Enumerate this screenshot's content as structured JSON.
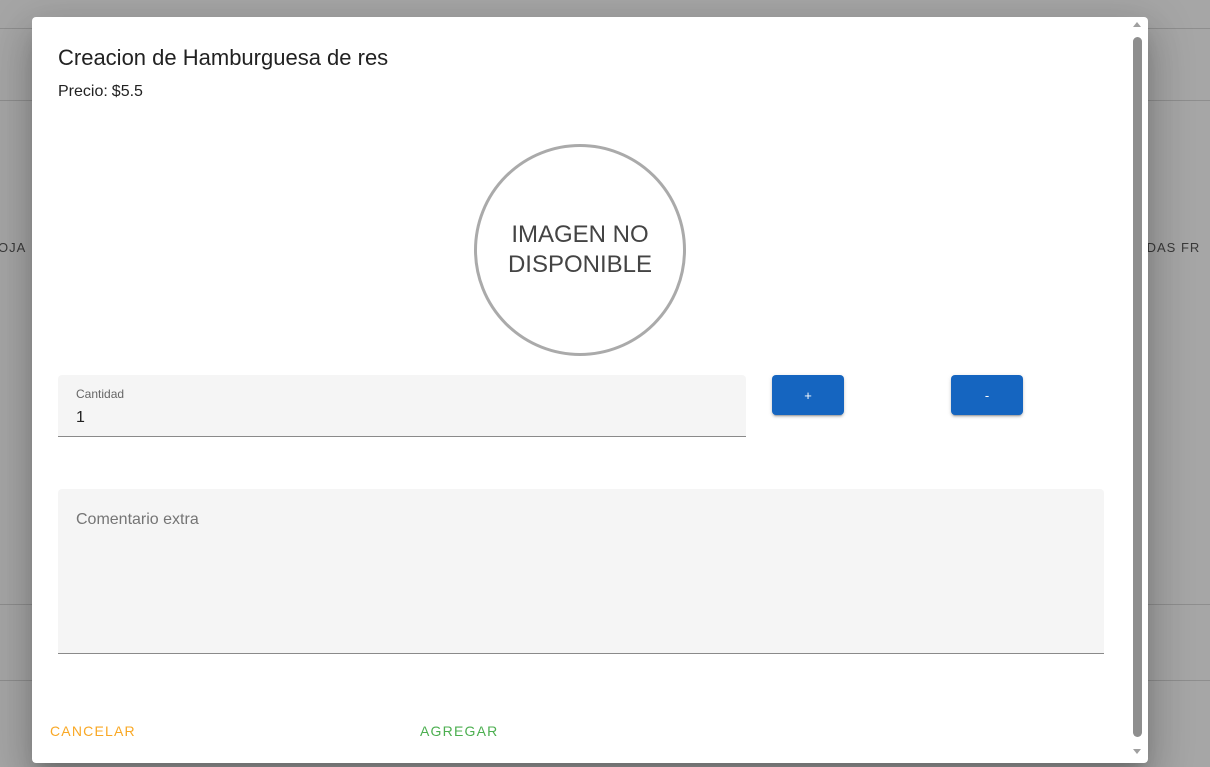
{
  "background": {
    "left_tab_fragment": "OJA",
    "right_tab_fragment": "IDAS FR"
  },
  "dialog": {
    "title": "Creacion de Hamburguesa de res",
    "price_label": "Precio:",
    "price_value": "$5.5",
    "image_placeholder_line1": "IMAGEN NO",
    "image_placeholder_line2": "DISPONIBLE",
    "quantity": {
      "label": "Cantidad",
      "value": "1"
    },
    "increment_label": "+",
    "decrement_label": "-",
    "comment": {
      "placeholder": "Comentario extra",
      "value": ""
    },
    "cancel_label": "CANCELAR",
    "add_label": "AGREGAR"
  },
  "colors": {
    "primary_button": "#1565c0",
    "cancel": "#f9a825",
    "add": "#4caf50"
  }
}
